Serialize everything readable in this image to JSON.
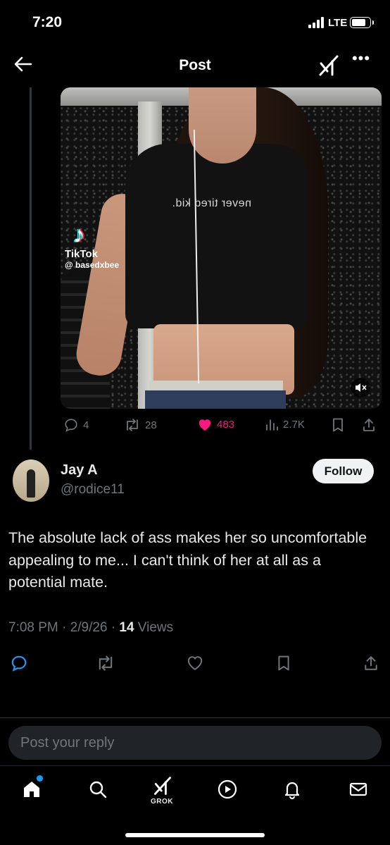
{
  "status_bar": {
    "time": "7:20",
    "network": "LTE",
    "battery_level": 0.78
  },
  "nav": {
    "title": "Post",
    "back_icon": "arrow-left-icon",
    "grok_icon": "grok-icon",
    "more_icon": "more-icon"
  },
  "media": {
    "shirt_text": "never tired kid.",
    "watermark_brand": "TikTok",
    "watermark_handle": "@ basedxbee",
    "mute_icon": "speaker-muted-icon"
  },
  "engagement": {
    "replies": "4",
    "reposts": "28",
    "likes": "483",
    "views": "2.7K",
    "liked": true
  },
  "author": {
    "name": "Jay A",
    "handle": "@rodice11",
    "follow_label": "Follow"
  },
  "post": {
    "text": "The absolute lack of ass makes her so uncomfortable appealing to me... I can't think of her at all as a potential mate.",
    "time": "7:08 PM",
    "date": "2/9/26",
    "views_count": "14",
    "views_label": "Views"
  },
  "reply": {
    "placeholder": "Post your reply"
  },
  "tabbar": {
    "grok_label": "GROK",
    "home_has_notification": true
  },
  "colors": {
    "background": "#000000",
    "like_pink": "#f91880",
    "accent_blue": "#1d9bf0",
    "muted_text": "#71767b"
  }
}
